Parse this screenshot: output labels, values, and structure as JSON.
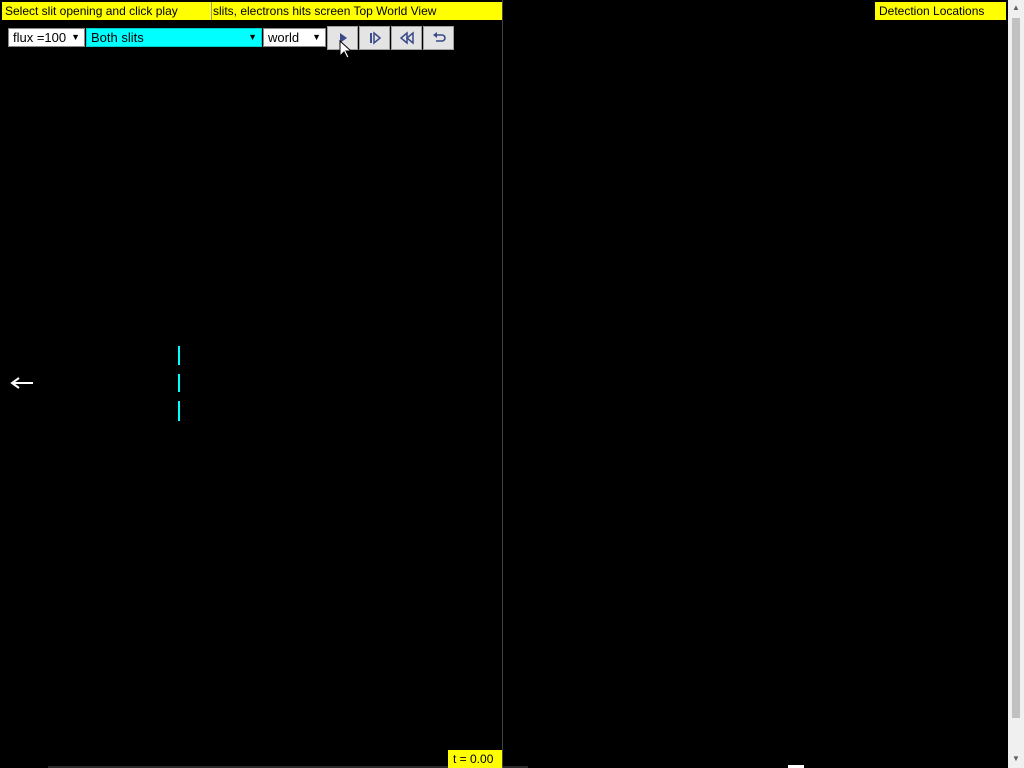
{
  "left": {
    "instruction": "Select slit opening and click play",
    "view_title": "slits, electrons hits screen Top World View",
    "flux_value": "flux =100",
    "slit_value": "Both slits",
    "view_value": "world",
    "time": "t = 0.00",
    "buttons": [
      "play-icon",
      "step-forward-icon",
      "rewind-icon",
      "reset-icon"
    ]
  },
  "right": {
    "title": "Detection Locations"
  },
  "colors": {
    "label_bg": "#ffff00",
    "slit_color": "#00ffff",
    "background": "#000000"
  }
}
